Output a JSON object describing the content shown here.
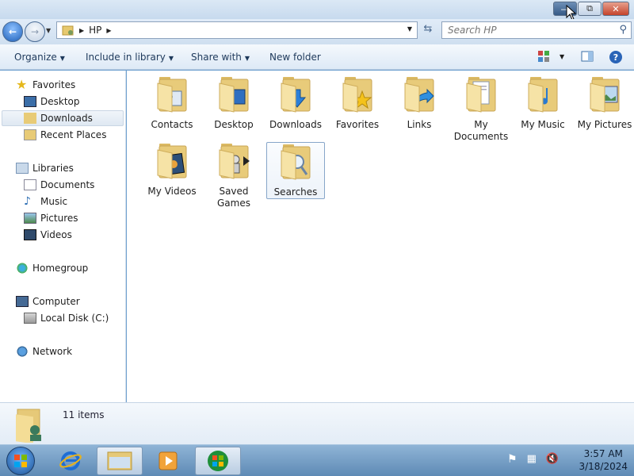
{
  "window": {
    "caption": {
      "minimize": "—",
      "maximize": "⧉",
      "close": "✕"
    }
  },
  "address": {
    "path": [
      "HP"
    ],
    "search_placeholder": "Search HP"
  },
  "toolbar": {
    "organize": "Organize",
    "include_in_library": "Include in library",
    "share_with": "Share with",
    "new_folder": "New folder"
  },
  "nav": {
    "favorites": "Favorites",
    "desktop": "Desktop",
    "downloads": "Downloads",
    "recent_places": "Recent Places",
    "libraries": "Libraries",
    "documents": "Documents",
    "music": "Music",
    "pictures": "Pictures",
    "videos": "Videos",
    "homegroup": "Homegroup",
    "computer": "Computer",
    "local_disk": "Local Disk (C:)",
    "network": "Network"
  },
  "items": [
    {
      "label": "Contacts",
      "icon": "contacts-icon"
    },
    {
      "label": "Desktop",
      "icon": "desktop-icon"
    },
    {
      "label": "Downloads",
      "icon": "downloads-icon"
    },
    {
      "label": "Favorites",
      "icon": "favorites-icon"
    },
    {
      "label": "Links",
      "icon": "links-icon"
    },
    {
      "label": "My Documents",
      "icon": "my-documents-icon"
    },
    {
      "label": "My Music",
      "icon": "my-music-icon"
    },
    {
      "label": "My Pictures",
      "icon": "my-pictures-icon"
    },
    {
      "label": "My Videos",
      "icon": "my-videos-icon"
    },
    {
      "label": "Saved Games",
      "icon": "saved-games-icon"
    },
    {
      "label": "Searches",
      "icon": "searches-icon"
    }
  ],
  "details": {
    "count": "11 items"
  },
  "taskbar": {
    "time": "3:57 AM",
    "date": "3/18/2024"
  },
  "colors": {
    "accent": "#1d5fb8",
    "folder": "#f0d890",
    "selection_border": "#87a6c9"
  }
}
